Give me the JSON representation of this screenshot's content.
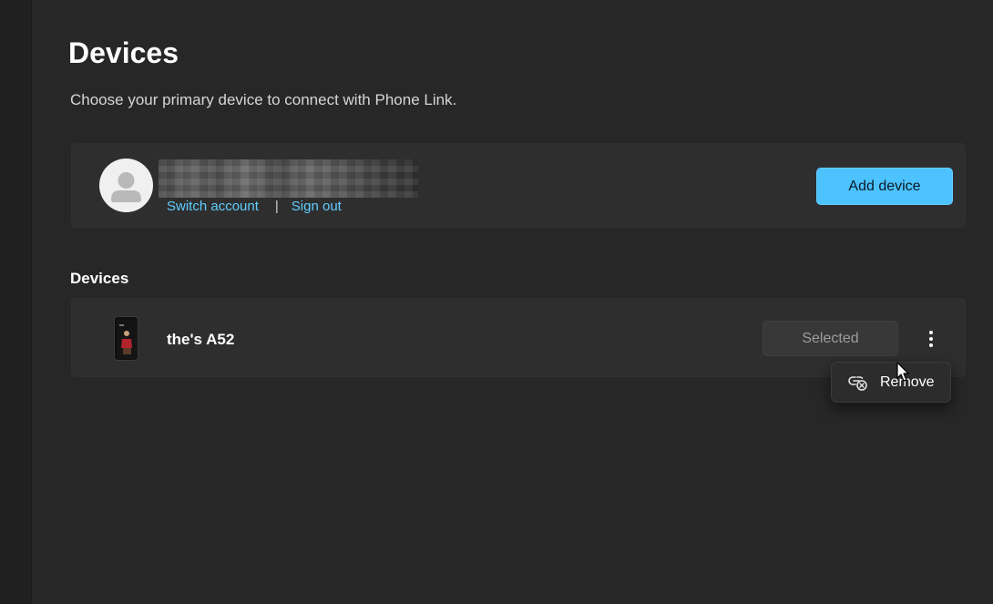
{
  "page": {
    "title": "Devices",
    "subtitle": "Choose your primary device to connect with Phone Link."
  },
  "account": {
    "switch_account": "Switch account",
    "separator": "|",
    "sign_out": "Sign out",
    "add_device": "Add device"
  },
  "devices_section": {
    "heading": "Devices",
    "items": [
      {
        "name": "the's A52",
        "status_button": "Selected"
      }
    ]
  },
  "context_menu": {
    "items": [
      {
        "label": "Remove",
        "icon": "unlink-icon"
      }
    ]
  },
  "colors": {
    "background": "#272727",
    "card": "#2e2e2e",
    "accent": "#4cc2ff",
    "link": "#60cdff"
  }
}
